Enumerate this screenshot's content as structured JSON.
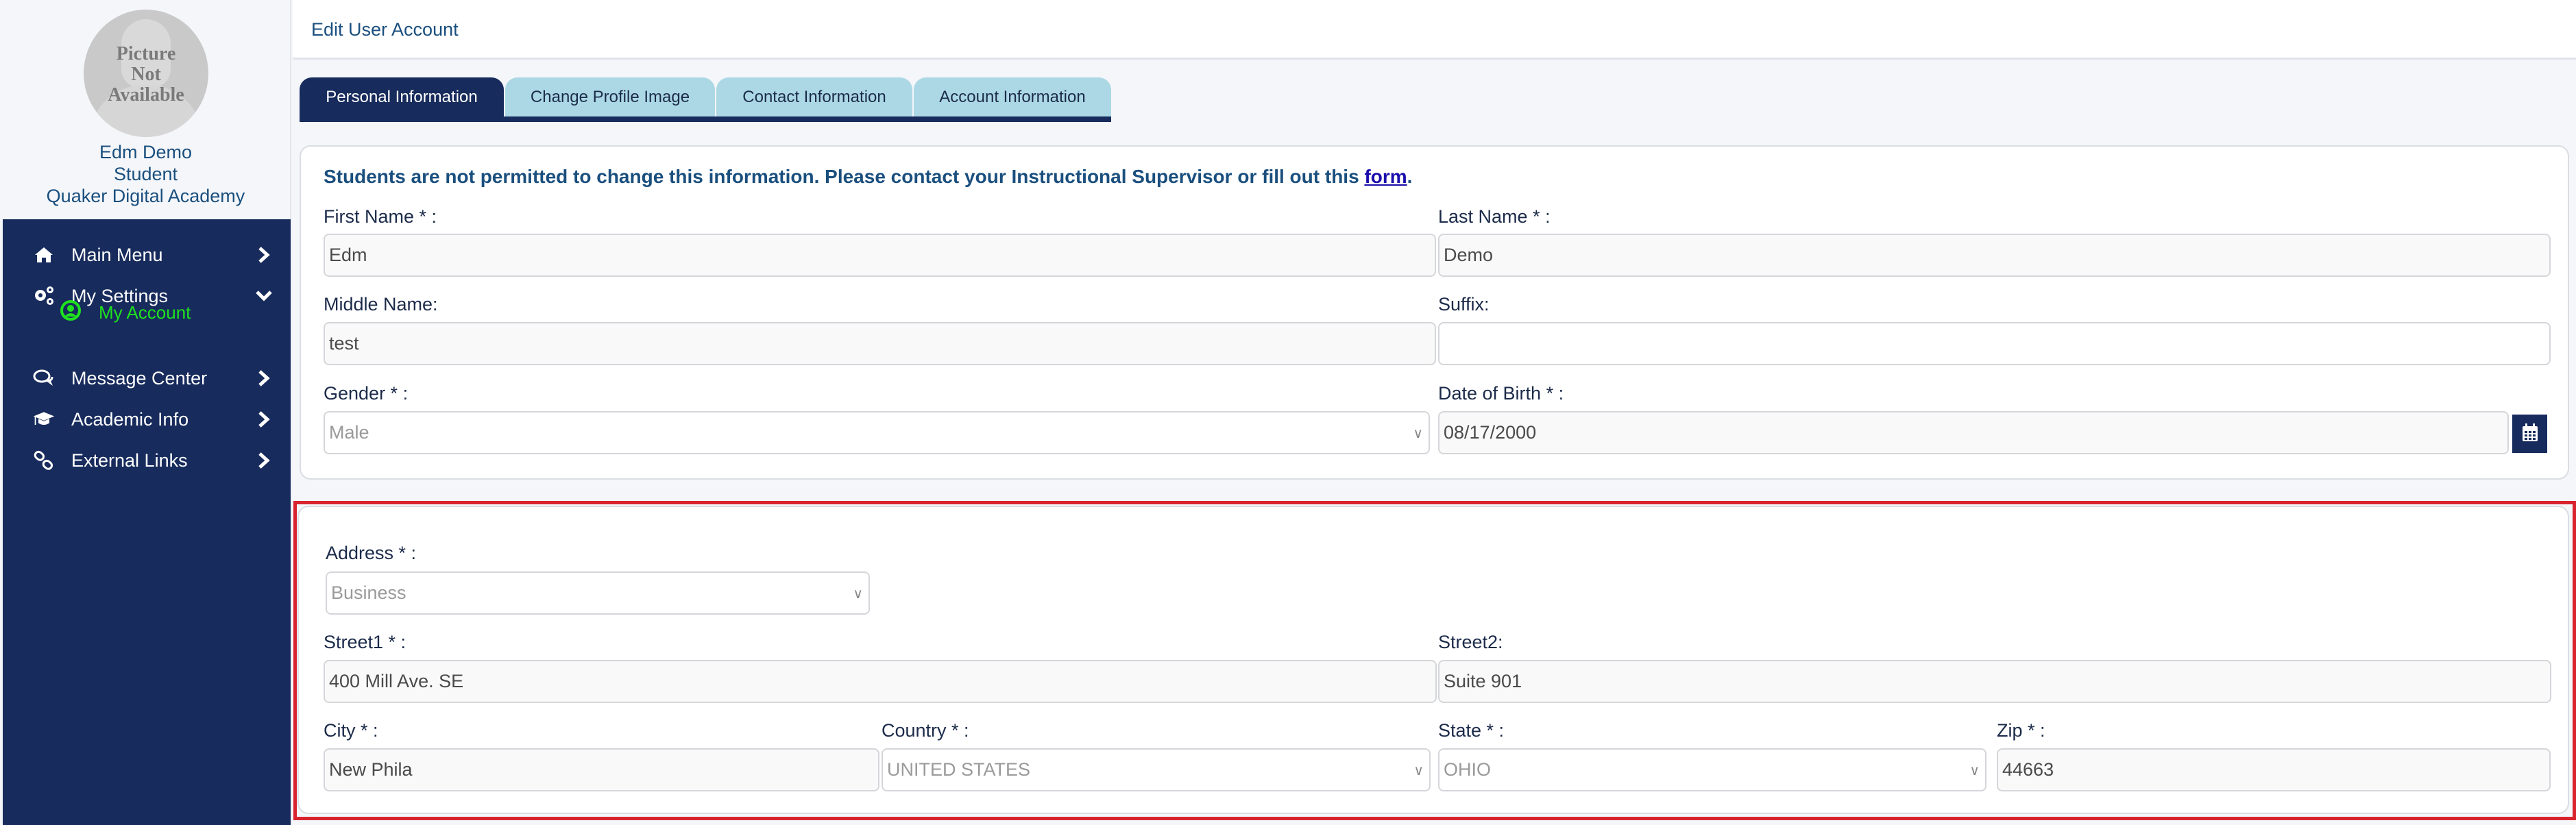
{
  "sidebar": {
    "avatar_text": [
      "Picture",
      "Not",
      "Available"
    ],
    "user_name": "Edm Demo",
    "user_role": "Student",
    "school": "Quaker Digital Academy",
    "nav": [
      {
        "label": "Main Menu",
        "icon": "home-icon",
        "expanded": false
      },
      {
        "label": "My Settings",
        "icon": "gears-icon",
        "expanded": true
      },
      {
        "label": "Message Center",
        "icon": "comments-icon",
        "expanded": false
      },
      {
        "label": "Academic Info",
        "icon": "graduation-cap-icon",
        "expanded": false
      },
      {
        "label": "External Links",
        "icon": "link-icon",
        "expanded": false
      }
    ],
    "sub_item": {
      "label": "My Account",
      "icon": "user-circle-icon",
      "color": "#1fe21f"
    }
  },
  "header": {
    "title": "Edit User Account"
  },
  "tabs": [
    {
      "label": "Personal Information",
      "active": true
    },
    {
      "label": "Change Profile Image",
      "active": false
    },
    {
      "label": "Contact Information",
      "active": false
    },
    {
      "label": "Account Information",
      "active": false
    }
  ],
  "personal": {
    "notice_text": "Students are not permitted to change this information. Please contact your Instructional Supervisor or fill out this ",
    "notice_link": "form",
    "notice_end": ".",
    "first_name": {
      "label": "First Name * :",
      "value": "Edm"
    },
    "last_name": {
      "label": "Last Name * :",
      "value": "Demo"
    },
    "middle_name": {
      "label": "Middle Name:",
      "value": "test"
    },
    "suffix": {
      "label": "Suffix:",
      "value": ""
    },
    "gender": {
      "label": "Gender * :",
      "value": "Male"
    },
    "dob": {
      "label": "Date of Birth * :",
      "value": "08/17/2000"
    }
  },
  "address": {
    "type": {
      "label": "Address * :",
      "value": "Business"
    },
    "street1": {
      "label": "Street1 * :",
      "value": "400 Mill Ave. SE"
    },
    "street2": {
      "label": "Street2:",
      "value": "Suite 901"
    },
    "city": {
      "label": "City * :",
      "value": "New Phila"
    },
    "country": {
      "label": "Country * :",
      "value": "UNITED STATES"
    },
    "state": {
      "label": "State * :",
      "value": "OHIO"
    },
    "zip": {
      "label": "Zip * :",
      "value": "44663"
    }
  },
  "colors": {
    "navy": "#172b5c",
    "tab_inactive": "#acd8e5",
    "highlight_border": "#d9232e",
    "link": "#1a0dab",
    "title_blue": "#1a4f7e"
  }
}
